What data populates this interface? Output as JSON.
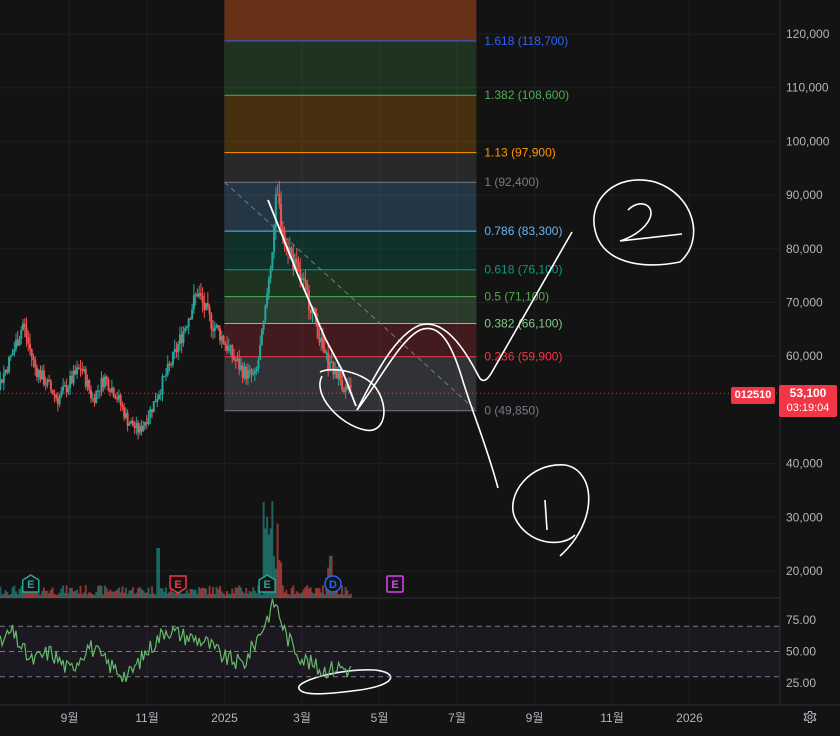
{
  "chart_data": {
    "type": "candlestick",
    "symbol": "012510",
    "last_price": "53,100",
    "countdown": "03:19:04",
    "price_axis": {
      "ticks": [
        {
          "label": "120,000",
          "value": 120000
        },
        {
          "label": "110,000",
          "value": 110000
        },
        {
          "label": "100,000",
          "value": 100000
        },
        {
          "label": "90,000",
          "value": 90000
        },
        {
          "label": "80,000",
          "value": 80000
        },
        {
          "label": "70,000",
          "value": 70000
        },
        {
          "label": "60,000",
          "value": 60000
        },
        {
          "label": "40,000",
          "value": 40000
        },
        {
          "label": "30,000",
          "value": 30000
        },
        {
          "label": "20,000",
          "value": 20000
        }
      ]
    },
    "time_axis": {
      "labels": [
        {
          "label": "9월",
          "month": 8
        },
        {
          "label": "11월",
          "month": 10
        },
        {
          "label": "2025",
          "month": 12
        },
        {
          "label": "3월",
          "month": 14
        },
        {
          "label": "5월",
          "month": 16
        },
        {
          "label": "7월",
          "month": 18
        },
        {
          "label": "9월",
          "month": 20
        },
        {
          "label": "11월",
          "month": 22
        },
        {
          "label": "2026",
          "month": 24
        }
      ]
    },
    "fib": {
      "start_month": 12.0,
      "end_month": 18.5,
      "levels": [
        {
          "label": "1.618 (118,700)",
          "ratio": 1.618,
          "price": 118700,
          "color": "#2962ff"
        },
        {
          "label": "1.382 (108,600)",
          "ratio": 1.382,
          "price": 108600,
          "color": "#4caf50"
        },
        {
          "label": "1.13 (97,900)",
          "ratio": 1.13,
          "price": 97900,
          "color": "#ff9800"
        },
        {
          "label": "1 (92,400)",
          "ratio": 1,
          "price": 92400,
          "color": "#787b86"
        },
        {
          "label": "0.786 (83,300)",
          "ratio": 0.786,
          "price": 83300,
          "color": "#64b5f6"
        },
        {
          "label": "0.618 (76,100)",
          "ratio": 0.618,
          "price": 76100,
          "color": "#089981"
        },
        {
          "label": "0.5 (71,100)",
          "ratio": 0.5,
          "price": 71100,
          "color": "#4caf50"
        },
        {
          "label": "0.382 (66,100)",
          "ratio": 0.382,
          "price": 66100,
          "color": "#81c784"
        },
        {
          "label": "0.236 (59,900)",
          "ratio": 0.236,
          "price": 59900,
          "color": "#f23645"
        },
        {
          "label": "0 (49,850)",
          "ratio": 0,
          "price": 49850,
          "color": "#787b86"
        }
      ]
    },
    "price_path": [
      {
        "m": 5.0,
        "p": 75000
      },
      {
        "m": 5.3,
        "p": 68000
      },
      {
        "m": 5.6,
        "p": 64000
      },
      {
        "m": 5.9,
        "p": 57000
      },
      {
        "m": 6.2,
        "p": 55000
      },
      {
        "m": 6.5,
        "p": 60000
      },
      {
        "m": 6.8,
        "p": 66000
      },
      {
        "m": 7.1,
        "p": 58000
      },
      {
        "m": 7.4,
        "p": 55000
      },
      {
        "m": 7.7,
        "p": 52000
      },
      {
        "m": 8.0,
        "p": 55000
      },
      {
        "m": 8.3,
        "p": 58000
      },
      {
        "m": 8.6,
        "p": 52000
      },
      {
        "m": 8.9,
        "p": 56000
      },
      {
        "m": 9.2,
        "p": 53000
      },
      {
        "m": 9.5,
        "p": 48000
      },
      {
        "m": 9.8,
        "p": 46000
      },
      {
        "m": 10.1,
        "p": 50000
      },
      {
        "m": 10.4,
        "p": 55000
      },
      {
        "m": 10.7,
        "p": 60000
      },
      {
        "m": 11.0,
        "p": 66000
      },
      {
        "m": 11.3,
        "p": 72000
      },
      {
        "m": 11.6,
        "p": 67000
      },
      {
        "m": 11.9,
        "p": 64000
      },
      {
        "m": 12.2,
        "p": 60000
      },
      {
        "m": 12.5,
        "p": 57000
      },
      {
        "m": 12.8,
        "p": 56000
      },
      {
        "m": 13.0,
        "p": 65000
      },
      {
        "m": 13.2,
        "p": 78000
      },
      {
        "m": 13.35,
        "p": 90000
      },
      {
        "m": 13.5,
        "p": 84000
      },
      {
        "m": 13.8,
        "p": 77000
      },
      {
        "m": 14.1,
        "p": 72000
      },
      {
        "m": 14.3,
        "p": 68000
      },
      {
        "m": 14.5,
        "p": 62000
      },
      {
        "m": 14.7,
        "p": 58000
      },
      {
        "m": 14.9,
        "p": 57000
      },
      {
        "m": 15.1,
        "p": 54000
      },
      {
        "m": 15.3,
        "p": 53100
      }
    ],
    "volume_events": [
      {
        "label": "E",
        "month": 7.0,
        "color": "#26a69a"
      },
      {
        "label": "E",
        "month": 10.8,
        "color": "#f23645"
      },
      {
        "label": "E",
        "month": 13.1,
        "color": "#26a69a"
      },
      {
        "label": "D",
        "month": 14.8,
        "color": "#2962ff"
      },
      {
        "label": "E",
        "month": 16.4,
        "color": "#e040fb"
      }
    ],
    "rsi": {
      "ticks": [
        {
          "label": "75.00",
          "value": 75
        },
        {
          "label": "50.00",
          "value": 50
        },
        {
          "label": "25.00",
          "value": 25
        }
      ],
      "upper": 70,
      "middle": 50,
      "lower": 30,
      "values": [
        {
          "m": 5.0,
          "v": 40
        },
        {
          "m": 5.5,
          "v": 30
        },
        {
          "m": 6.0,
          "v": 48
        },
        {
          "m": 6.5,
          "v": 66
        },
        {
          "m": 7.0,
          "v": 42
        },
        {
          "m": 7.5,
          "v": 50
        },
        {
          "m": 8.0,
          "v": 35
        },
        {
          "m": 8.5,
          "v": 55
        },
        {
          "m": 9.0,
          "v": 40
        },
        {
          "m": 9.5,
          "v": 30
        },
        {
          "m": 10.0,
          "v": 50
        },
        {
          "m": 10.5,
          "v": 68
        },
        {
          "m": 11.0,
          "v": 62
        },
        {
          "m": 11.5,
          "v": 58
        },
        {
          "m": 12.0,
          "v": 45
        },
        {
          "m": 12.5,
          "v": 40
        },
        {
          "m": 13.0,
          "v": 70
        },
        {
          "m": 13.3,
          "v": 90
        },
        {
          "m": 13.6,
          "v": 62
        },
        {
          "m": 14.0,
          "v": 45
        },
        {
          "m": 14.5,
          "v": 35
        },
        {
          "m": 15.0,
          "v": 38
        },
        {
          "m": 15.3,
          "v": 34
        }
      ]
    }
  }
}
